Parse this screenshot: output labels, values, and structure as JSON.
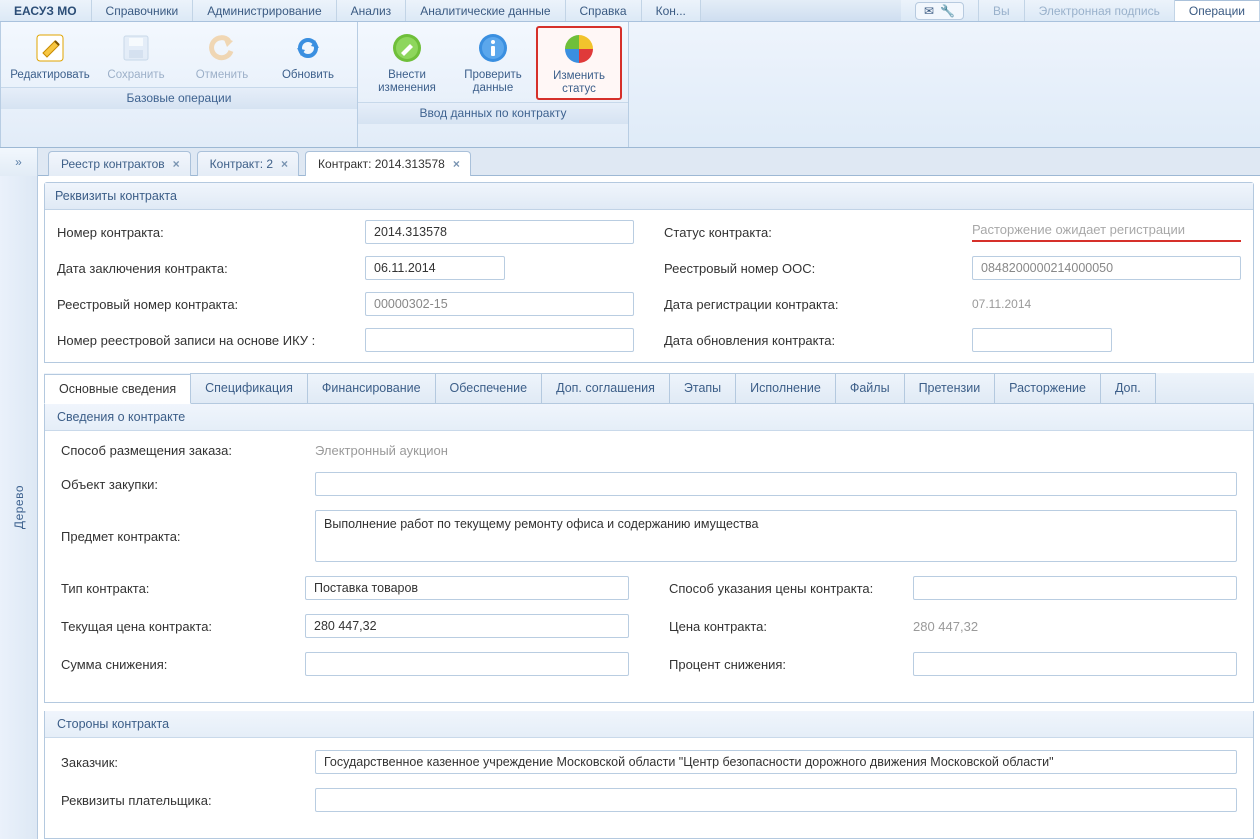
{
  "header": {
    "app": "ЕАСУЗ МО",
    "menu": [
      "Справочники",
      "Администрирование",
      "Анализ",
      "Аналитические данные",
      "Справка",
      "Кон..."
    ],
    "right1": "Вы",
    "right2": "Электронная подпись",
    "right3": "Операции"
  },
  "ribbon": {
    "group1": {
      "caption": "Базовые операции",
      "edit": "Редактировать",
      "save": "Сохранить",
      "cancel": "Отменить",
      "refresh": "Обновить"
    },
    "group2": {
      "caption": "Ввод данных по контракту",
      "changes": "Внести изменения",
      "check": "Проверить данные",
      "status": "Изменить статус"
    }
  },
  "tabs": {
    "t1": "Реестр контрактов",
    "t2": "Контракт: 2",
    "t3": "Контракт: 2014.313578",
    "expand": "»"
  },
  "side": {
    "label": "Дерево"
  },
  "req": {
    "title": "Реквизиты контракта",
    "num_lbl": "Номер контракта:",
    "num_val": "2014.313578",
    "status_lbl": "Статус контракта:",
    "status_val": "Расторжение ожидает регистрации",
    "date_lbl": "Дата заключения контракта:",
    "date_val": "06.11.2014",
    "oos_lbl": "Реестровый номер ООС:",
    "oos_val": "0848200000214000050",
    "rnum_lbl": "Реестровый номер контракта:",
    "rnum_val": "00000302-15",
    "regdate_lbl": "Дата регистрации контракта:",
    "regdate_val": "07.11.2014",
    "iku_lbl": "Номер реестровой записи на основе ИКУ :",
    "iku_val": "",
    "upd_lbl": "Дата обновления контракта:",
    "upd_val": ""
  },
  "subtabs": {
    "t0": "Основные сведения",
    "t1": "Спецификация",
    "t2": "Финансирование",
    "t3": "Обеспечение",
    "t4": "Доп. соглашения",
    "t5": "Этапы",
    "t6": "Исполнение",
    "t7": "Файлы",
    "t8": "Претензии",
    "t9": "Расторжение",
    "t10": "Доп."
  },
  "info": {
    "title": "Сведения о контракте",
    "method_lbl": "Способ размещения заказа:",
    "method_val": "Электронный аукцион",
    "obj_lbl": "Объект закупки:",
    "obj_val": "",
    "subj_lbl": "Предмет контракта:",
    "subj_val": "Выполнение работ по текущему ремонту офиса и содержанию имущества",
    "type_lbl": "Тип контракта:",
    "type_val": "Поставка товаров",
    "pricemode_lbl": "Способ указания цены контракта:",
    "pricemode_val": "",
    "curprice_lbl": "Текущая цена контракта:",
    "curprice_val": "280 447,32",
    "price_lbl": "Цена контракта:",
    "price_val": "280 447,32",
    "discsum_lbl": "Сумма снижения:",
    "discsum_val": "",
    "discpct_lbl": "Процент снижения:",
    "discpct_val": ""
  },
  "parties": {
    "title": "Стороны контракта",
    "cust_lbl": "Заказчик:",
    "cust_val": "Государственное казенное учреждение Московской области \"Центр безопасности дорожного движения Московской области\"",
    "payer_lbl": "Реквизиты плательщика:",
    "payer_val": ""
  }
}
